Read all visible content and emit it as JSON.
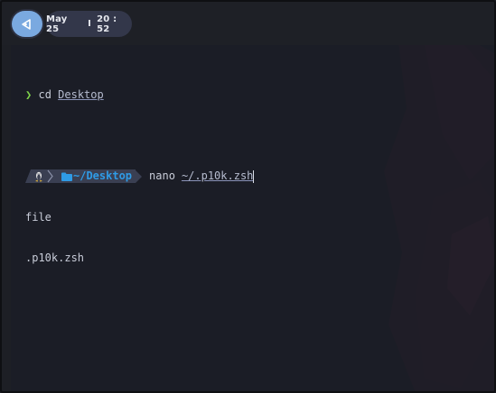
{
  "topbar": {
    "launcher_icon": "launcher-icon",
    "date": "May 25",
    "separator": "I",
    "time": "20 : 52"
  },
  "terminal": {
    "prev_command": {
      "prompt_symbol": "❯",
      "command": "cd",
      "argument": "Desktop"
    },
    "prompt": {
      "os_icon": "linux-icon",
      "folder_icon": "folder-icon",
      "path_prefix": "~/",
      "path_dir": "Desktop"
    },
    "current_command": {
      "command": "nano",
      "argument": "~/.p10k.zsh"
    },
    "output": [
      "file",
      ".p10k.zsh"
    ]
  },
  "colors": {
    "accent_blue": "#2f9be6",
    "prompt_green": "#7fd34a",
    "launcher_blue": "#7aa9e0",
    "pill_bg": "#33374a"
  }
}
